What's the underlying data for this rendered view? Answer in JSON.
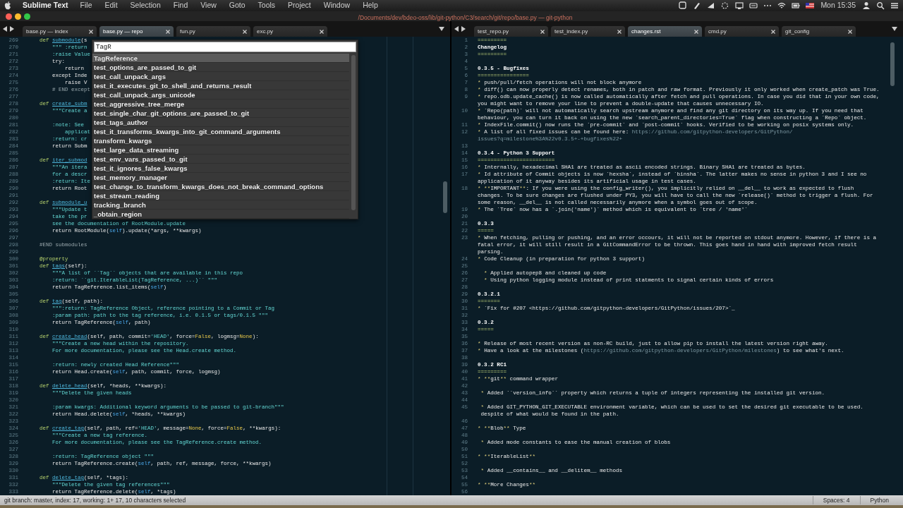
{
  "menubar": {
    "app": "Sublime Text",
    "menus": [
      "File",
      "Edit",
      "Selection",
      "Find",
      "View",
      "Goto",
      "Tools",
      "Project",
      "Window",
      "Help"
    ],
    "clock": "Mon 15:35"
  },
  "window": {
    "title": "/Documents/dev/bdeo-oss/lib/git-python/C3/search/git/repo/base.py — git-python"
  },
  "panes": [
    {
      "tabs": [
        {
          "label": "base.py — index",
          "selected": false
        },
        {
          "label": "base.py — repo",
          "selected": true
        },
        {
          "label": "fun.py",
          "selected": false
        },
        {
          "label": "exc.py",
          "selected": false
        }
      ],
      "lines": [
        {
          "n": "269",
          "parts": [
            {
              "kind": "kw",
              "text": "    def "
            },
            {
              "kind": "fn",
              "text": "submodule"
            },
            {
              "kind": "pl",
              "text": "(s"
            }
          ]
        },
        {
          "n": "270",
          "parts": [
            {
              "kind": "doc",
              "text": "        \"\"\" :return"
            }
          ]
        },
        {
          "n": "271",
          "parts": [
            {
              "kind": "doc",
              "text": "        :raise Value"
            }
          ]
        },
        {
          "n": "272",
          "parts": [
            {
              "kind": "pl",
              "text": "        try:"
            }
          ]
        },
        {
          "n": "273",
          "parts": [
            {
              "kind": "pl",
              "text": "            return"
            }
          ]
        },
        {
          "n": "274",
          "parts": [
            {
              "kind": "pl",
              "text": "        except Inde"
            }
          ]
        },
        {
          "n": "275",
          "parts": [
            {
              "kind": "pl",
              "text": "            raise V"
            }
          ]
        },
        {
          "n": "276",
          "parts": [
            {
              "kind": "cmt",
              "text": "        # END except"
            }
          ]
        },
        {
          "n": "277"
        },
        {
          "n": "278",
          "parts": [
            {
              "kind": "kw",
              "text": "    def "
            },
            {
              "kind": "fn",
              "text": "create_subm"
            }
          ]
        },
        {
          "n": "279",
          "parts": [
            {
              "kind": "doc",
              "text": "        \"\"\"Create a"
            }
          ]
        },
        {
          "n": "280"
        },
        {
          "n": "281",
          "parts": [
            {
              "kind": "doc",
              "text": "        :note: See"
            }
          ]
        },
        {
          "n": "282",
          "parts": [
            {
              "kind": "doc",
              "text": "            applicat"
            }
          ]
        },
        {
          "n": "283",
          "parts": [
            {
              "kind": "doc",
              "text": "        :return: cr"
            }
          ]
        },
        {
          "n": "284",
          "parts": [
            {
              "kind": "pl",
              "text": "        return Subm"
            }
          ]
        },
        {
          "n": "285"
        },
        {
          "n": "286",
          "parts": [
            {
              "kind": "kw",
              "text": "    def "
            },
            {
              "kind": "fn",
              "text": "iter_submod"
            }
          ]
        },
        {
          "n": "287",
          "parts": [
            {
              "kind": "doc",
              "text": "        \"\"\"An itera"
            }
          ]
        },
        {
          "n": "288",
          "parts": [
            {
              "kind": "doc",
              "text": "        for a descr"
            }
          ]
        },
        {
          "n": "289",
          "parts": [
            {
              "kind": "doc",
              "text": "        :return: Ite"
            }
          ]
        },
        {
          "n": "290",
          "parts": [
            {
              "kind": "pl",
              "text": "        return Root"
            }
          ]
        },
        {
          "n": "291"
        },
        {
          "n": "292",
          "parts": [
            {
              "kind": "kw",
              "text": "    def "
            },
            {
              "kind": "fn",
              "text": "submodule_u"
            }
          ]
        },
        {
          "n": "293",
          "parts": [
            {
              "kind": "doc",
              "text": "        \"\"\"Update t"
            }
          ]
        },
        {
          "n": "294",
          "parts": [
            {
              "kind": "doc",
              "text": "        take the pr"
            }
          ]
        },
        {
          "n": "295",
          "parts": [
            {
              "kind": "doc",
              "text": "        see the documentation of RootModule.update"
            }
          ]
        },
        {
          "n": "296",
          "parts": [
            {
              "kind": "pl",
              "text": "        return RootModule("
            },
            {
              "kind": "self",
              "text": "self"
            },
            {
              "kind": "pl",
              "text": ").update(*args, **kwargs)"
            }
          ]
        },
        {
          "n": "297"
        },
        {
          "n": "298",
          "parts": [
            {
              "kind": "cmt",
              "text": "    #END submodules"
            }
          ]
        },
        {
          "n": "299"
        },
        {
          "n": "300",
          "parts": [
            {
              "kind": "dec",
              "text": "    @property"
            }
          ]
        },
        {
          "n": "301",
          "parts": [
            {
              "kind": "kw",
              "text": "    def "
            },
            {
              "kind": "fn",
              "text": "tags"
            },
            {
              "kind": "pl",
              "text": "(self):"
            }
          ]
        },
        {
          "n": "302",
          "parts": [
            {
              "kind": "doc",
              "text": "        \"\"\"A list of ``Tag`` objects that are available in this repo"
            }
          ]
        },
        {
          "n": "303",
          "parts": [
            {
              "kind": "doc",
              "text": "        :return: ``git.IterableList(TagReference, ...)`` \"\"\""
            }
          ]
        },
        {
          "n": "304",
          "parts": [
            {
              "kind": "pl",
              "text": "        return TagReference.list_items("
            },
            {
              "kind": "self",
              "text": "self"
            },
            {
              "kind": "pl",
              "text": ")"
            }
          ]
        },
        {
          "n": "305"
        },
        {
          "n": "306",
          "parts": [
            {
              "kind": "kw",
              "text": "    def "
            },
            {
              "kind": "fn",
              "text": "tag"
            },
            {
              "kind": "pl",
              "text": "(self, path):"
            }
          ]
        },
        {
          "n": "307",
          "parts": [
            {
              "kind": "doc",
              "text": "        \"\"\":return: TagReference Object, reference pointing to a Commit or Tag"
            }
          ]
        },
        {
          "n": "308",
          "parts": [
            {
              "kind": "doc",
              "text": "        :param path: path to the tag reference, i.e. 0.1.5 or tags/0.1.5 \"\"\""
            }
          ]
        },
        {
          "n": "309",
          "parts": [
            {
              "kind": "pl",
              "text": "        return TagReference("
            },
            {
              "kind": "self",
              "text": "self"
            },
            {
              "kind": "pl",
              "text": ", path)"
            }
          ]
        },
        {
          "n": "310"
        },
        {
          "n": "311",
          "parts": [
            {
              "kind": "kw",
              "text": "    def "
            },
            {
              "kind": "fn",
              "text": "create_head"
            },
            {
              "kind": "pl",
              "text": "(self, path, commit="
            },
            {
              "kind": "doc",
              "text": "'HEAD'"
            },
            {
              "kind": "pl",
              "text": ", force="
            },
            {
              "kind": "const",
              "text": "False"
            },
            {
              "kind": "pl",
              "text": ", logmsg="
            },
            {
              "kind": "const",
              "text": "None"
            },
            {
              "kind": "pl",
              "text": "):"
            }
          ]
        },
        {
          "n": "312",
          "parts": [
            {
              "kind": "doc",
              "text": "        \"\"\"Create a new head within the repository."
            }
          ]
        },
        {
          "n": "313",
          "parts": [
            {
              "kind": "doc",
              "text": "        For more documentation, please see the Head.create method."
            }
          ]
        },
        {
          "n": "314"
        },
        {
          "n": "315",
          "parts": [
            {
              "kind": "doc",
              "text": "        :return: newly created Head Reference\"\"\""
            }
          ]
        },
        {
          "n": "316",
          "parts": [
            {
              "kind": "pl",
              "text": "        return Head.create("
            },
            {
              "kind": "self",
              "text": "self"
            },
            {
              "kind": "pl",
              "text": ", path, commit, force, logmsg)"
            }
          ]
        },
        {
          "n": "317"
        },
        {
          "n": "318",
          "parts": [
            {
              "kind": "kw",
              "text": "    def "
            },
            {
              "kind": "fn",
              "text": "delete_head"
            },
            {
              "kind": "pl",
              "text": "(self, *heads, **kwargs):"
            }
          ]
        },
        {
          "n": "319",
          "parts": [
            {
              "kind": "doc",
              "text": "        \"\"\"Delete the given heads"
            }
          ]
        },
        {
          "n": "320"
        },
        {
          "n": "321",
          "parts": [
            {
              "kind": "doc",
              "text": "        :param kwargs: Additional keyword arguments to be passed to git-branch\"\"\""
            }
          ]
        },
        {
          "n": "322",
          "parts": [
            {
              "kind": "pl",
              "text": "        return Head.delete("
            },
            {
              "kind": "self",
              "text": "self"
            },
            {
              "kind": "pl",
              "text": ", *heads, **kwargs)"
            }
          ]
        },
        {
          "n": "323"
        },
        {
          "n": "324",
          "parts": [
            {
              "kind": "kw",
              "text": "    def "
            },
            {
              "kind": "fn",
              "text": "create_tag"
            },
            {
              "kind": "pl",
              "text": "(self, path, ref="
            },
            {
              "kind": "doc",
              "text": "'HEAD'"
            },
            {
              "kind": "pl",
              "text": ", message="
            },
            {
              "kind": "const",
              "text": "None"
            },
            {
              "kind": "pl",
              "text": ", force="
            },
            {
              "kind": "const",
              "text": "False"
            },
            {
              "kind": "pl",
              "text": ", **kwargs):"
            }
          ]
        },
        {
          "n": "325",
          "parts": [
            {
              "kind": "doc",
              "text": "        \"\"\"Create a new tag reference."
            }
          ]
        },
        {
          "n": "326",
          "parts": [
            {
              "kind": "doc",
              "text": "        For more documentation, please see the TagReference.create method."
            }
          ]
        },
        {
          "n": "327"
        },
        {
          "n": "328",
          "parts": [
            {
              "kind": "doc",
              "text": "        :return: TagReference object \"\"\""
            }
          ]
        },
        {
          "n": "329",
          "parts": [
            {
              "kind": "pl",
              "text": "        return TagReference.create("
            },
            {
              "kind": "self",
              "text": "self"
            },
            {
              "kind": "pl",
              "text": ", path, ref, message, force, **kwargs)"
            }
          ]
        },
        {
          "n": "330"
        },
        {
          "n": "331",
          "parts": [
            {
              "kind": "kw",
              "text": "    def "
            },
            {
              "kind": "fn",
              "text": "delete_tag"
            },
            {
              "kind": "pl",
              "text": "(self, *tags):"
            }
          ]
        },
        {
          "n": "332",
          "parts": [
            {
              "kind": "doc",
              "text": "        \"\"\"Delete the given tag references\"\"\""
            }
          ]
        },
        {
          "n": "333",
          "parts": [
            {
              "kind": "pl",
              "text": "        return TagReference.delete("
            },
            {
              "kind": "self",
              "text": "self"
            },
            {
              "kind": "pl",
              "text": ", *tags)"
            }
          ]
        }
      ],
      "autocomplete": {
        "value": "TagR",
        "items": [
          {
            "label": "TagReference",
            "selected": true
          },
          {
            "label": "test_options_are_passed_to_git",
            "selected": false
          },
          {
            "label": "test_call_unpack_args",
            "selected": false
          },
          {
            "label": "test_it_executes_git_to_shell_and_returns_result",
            "selected": false
          },
          {
            "label": "test_call_unpack_args_unicode",
            "selected": false
          },
          {
            "label": "test_aggressive_tree_merge",
            "selected": false
          },
          {
            "label": "test_single_char_git_options_are_passed_to_git",
            "selected": false
          },
          {
            "label": "test_tags_author",
            "selected": false
          },
          {
            "label": "test_it_transforms_kwargs_into_git_command_arguments",
            "selected": false
          },
          {
            "label": "transform_kwargs",
            "selected": false
          },
          {
            "label": "test_large_data_streaming",
            "selected": false
          },
          {
            "label": "test_env_vars_passed_to_git",
            "selected": false
          },
          {
            "label": "test_it_ignores_false_kwargs",
            "selected": false
          },
          {
            "label": "test_memory_manager",
            "selected": false
          },
          {
            "label": "test_change_to_transform_kwargs_does_not_break_command_options",
            "selected": false
          },
          {
            "label": "test_stream_reading",
            "selected": false
          },
          {
            "label": "tracking_branch",
            "selected": false
          },
          {
            "label": "_obtain_region",
            "selected": false
          }
        ]
      }
    },
    {
      "tabs": [
        {
          "label": "test_repo.py",
          "selected": false
        },
        {
          "label": "test_index.py",
          "selected": false
        },
        {
          "label": "changes.rst",
          "selected": true
        },
        {
          "label": "cmd.py",
          "selected": false
        },
        {
          "label": "git_config",
          "selected": false
        }
      ],
      "lines": [
        {
          "n": "1",
          "parts": [
            {
              "kind": "rule",
              "text": "========="
            }
          ]
        },
        {
          "n": "2",
          "parts": [
            {
              "kind": "head",
              "text": "Changelog"
            }
          ]
        },
        {
          "n": "3",
          "parts": [
            {
              "kind": "rule",
              "text": "========="
            }
          ]
        },
        {
          "n": "4"
        },
        {
          "n": "5",
          "parts": [
            {
              "kind": "head",
              "text": "0.3.5 - Bugfixes"
            }
          ]
        },
        {
          "n": "6",
          "parts": [
            {
              "kind": "rule",
              "text": "================"
            }
          ]
        },
        {
          "n": "7",
          "parts": [
            {
              "kind": "bul",
              "text": "* "
            },
            {
              "kind": "txt",
              "text": "push/pull/fetch operations will not block anymore"
            }
          ]
        },
        {
          "n": "8",
          "parts": [
            {
              "kind": "bul",
              "text": "* "
            },
            {
              "kind": "txt",
              "text": "diff() can now properly detect renames, both in patch and raw format. Previously it only worked when create_patch was True."
            }
          ]
        },
        {
          "n": "9",
          "parts": [
            {
              "kind": "bul",
              "text": "* "
            },
            {
              "kind": "txt",
              "text": "repo.odb.update_cache() is now called automatically after fetch and pull operations. In case you did that in your own code,"
            }
          ]
        },
        {
          "parts": [
            {
              "kind": "txt",
              "text": "you might want to remove your line to prevent a double-update that causes unnecessary IO."
            }
          ]
        },
        {
          "n": "10",
          "parts": [
            {
              "kind": "bul",
              "text": "* "
            },
            {
              "kind": "txt",
              "text": "`Repo(path)` will not automatically search upstream anymore and find any git directory on its way up. If you need that"
            }
          ]
        },
        {
          "parts": [
            {
              "kind": "txt",
              "text": "behaviour, you can turn it back on using the new `search_parent_directories=True` flag when constructing a `Repo` object."
            }
          ]
        },
        {
          "n": "11",
          "parts": [
            {
              "kind": "bul",
              "text": "* "
            },
            {
              "kind": "txt",
              "text": "IndexFile.commit() now runs the `pre-commit` and `post-commit` hooks. Verified to be working on posix systems only."
            }
          ]
        },
        {
          "n": "12",
          "parts": [
            {
              "kind": "bul",
              "text": "* "
            },
            {
              "kind": "txt",
              "text": "A list of all fixed issues can be found here: "
            },
            {
              "kind": "link",
              "text": "https://github.com/gitpython-developers/GitPython/"
            }
          ]
        },
        {
          "parts": [
            {
              "kind": "link",
              "text": "issues?q=milestone%3A%22v0.3.5+-+bugfixes%22+"
            }
          ]
        },
        {
          "n": "13"
        },
        {
          "n": "14",
          "parts": [
            {
              "kind": "head",
              "text": "0.3.4 - Python 3 Support"
            }
          ]
        },
        {
          "n": "15",
          "parts": [
            {
              "kind": "rule",
              "text": "========================"
            }
          ]
        },
        {
          "n": "16",
          "parts": [
            {
              "kind": "bul",
              "text": "* "
            },
            {
              "kind": "txt",
              "text": "Internally, hexadecimal SHA1 are treated as ascii encoded strings. Binary SHA1 are treated as bytes."
            }
          ]
        },
        {
          "n": "17",
          "parts": [
            {
              "kind": "bul",
              "text": "* "
            },
            {
              "kind": "txt",
              "text": "Id attribute of Commit objects is now `hexsha`, instead of `binsha`. The latter makes no sense in python 3 and I see no"
            }
          ]
        },
        {
          "parts": [
            {
              "kind": "txt",
              "text": "application of it anyway besides its artificial usage in test cases."
            }
          ]
        },
        {
          "n": "18",
          "parts": [
            {
              "kind": "bul",
              "text": "* **"
            },
            {
              "kind": "txt",
              "text": "IMPORTANT"
            },
            {
              "kind": "bul",
              "text": "**"
            },
            {
              "kind": "txt",
              "text": ": If you were using the config_writer(), you implicitly relied on __del__ to work as expected to flush"
            }
          ]
        },
        {
          "parts": [
            {
              "kind": "txt",
              "text": "changes. To be sure changes are flushed under PY3, you will have to call the new `release()` method to trigger a flush. For"
            }
          ]
        },
        {
          "parts": [
            {
              "kind": "txt",
              "text": "some reason, __del__ is not called necessarily anymore when a symbol goes out of scope."
            }
          ]
        },
        {
          "n": "19",
          "parts": [
            {
              "kind": "bul",
              "text": "* "
            },
            {
              "kind": "txt",
              "text": "The `Tree` now has a `.join('name')` method which is equivalent to `tree / 'name'`"
            }
          ]
        },
        {
          "n": "20"
        },
        {
          "n": "21",
          "parts": [
            {
              "kind": "head",
              "text": "0.3.3"
            }
          ]
        },
        {
          "n": "22",
          "parts": [
            {
              "kind": "rule",
              "text": "====="
            }
          ]
        },
        {
          "n": "23",
          "parts": [
            {
              "kind": "bul",
              "text": "* "
            },
            {
              "kind": "txt",
              "text": "When fetching, pulling or pushing, and an error occours, it will not be reported on stdout anymore. However, if there is a"
            }
          ]
        },
        {
          "parts": [
            {
              "kind": "txt",
              "text": "fatal error, it will still result in a GitCommandError to be thrown. This goes hand in hand with improved fetch result"
            }
          ]
        },
        {
          "parts": [
            {
              "kind": "txt",
              "text": "parsing."
            }
          ]
        },
        {
          "n": "24",
          "parts": [
            {
              "kind": "bul",
              "text": "* "
            },
            {
              "kind": "txt",
              "text": "Code Cleanup (in preparation for python 3 support)"
            }
          ]
        },
        {
          "n": "25"
        },
        {
          "n": "26",
          "parts": [
            {
              "kind": "bul",
              "text": "  * "
            },
            {
              "kind": "txt",
              "text": "Applied autopep8 and cleaned up code"
            }
          ]
        },
        {
          "n": "27",
          "parts": [
            {
              "kind": "bul",
              "text": "  * "
            },
            {
              "kind": "txt",
              "text": "Using python logging module instead of print statments to signal certain kinds of errors"
            }
          ]
        },
        {
          "n": "28"
        },
        {
          "n": "29",
          "parts": [
            {
              "kind": "head",
              "text": "0.3.2.1"
            }
          ]
        },
        {
          "n": "30",
          "parts": [
            {
              "kind": "rule",
              "text": "======="
            }
          ]
        },
        {
          "n": "31",
          "parts": [
            {
              "kind": "bul",
              "text": "* "
            },
            {
              "kind": "txt",
              "text": "`Fix for #207 <https://github.com/gitpython-developers/GitPython/issues/207>`_"
            }
          ]
        },
        {
          "n": "32"
        },
        {
          "n": "33",
          "parts": [
            {
              "kind": "head",
              "text": "0.3.2"
            }
          ]
        },
        {
          "n": "34",
          "parts": [
            {
              "kind": "rule",
              "text": "====="
            }
          ]
        },
        {
          "n": "35"
        },
        {
          "n": "36",
          "parts": [
            {
              "kind": "bul",
              "text": "* "
            },
            {
              "kind": "txt",
              "text": "Release of most recent version as non-RC build, just to allow pip to install the latest version right away."
            }
          ]
        },
        {
          "n": "37",
          "parts": [
            {
              "kind": "bul",
              "text": "* "
            },
            {
              "kind": "txt",
              "text": "Have a look at the milestones ("
            },
            {
              "kind": "link",
              "text": "https://github.com/gitpython-developers/GitPython/milestones"
            },
            {
              "kind": "txt",
              "text": ") to see what's next."
            }
          ]
        },
        {
          "n": "38"
        },
        {
          "n": "39",
          "parts": [
            {
              "kind": "head",
              "text": "0.3.2 RC1"
            }
          ]
        },
        {
          "n": "40",
          "parts": [
            {
              "kind": "rule",
              "text": "========="
            }
          ]
        },
        {
          "n": "41",
          "parts": [
            {
              "kind": "bul",
              "text": "* **"
            },
            {
              "kind": "txt",
              "text": "git"
            },
            {
              "kind": "bul",
              "text": "**"
            },
            {
              "kind": "txt",
              "text": " command wrapper"
            }
          ]
        },
        {
          "n": "42"
        },
        {
          "n": "43",
          "parts": [
            {
              "kind": "bul",
              "text": " * "
            },
            {
              "kind": "txt",
              "text": "Added ``version_info`` property which returns a tuple of integers representing the installed git version."
            }
          ]
        },
        {
          "n": "44"
        },
        {
          "n": "45",
          "parts": [
            {
              "kind": "bul",
              "text": " * "
            },
            {
              "kind": "txt",
              "text": "Added GIT_PYTHON_GIT_EXECUTABLE environment variable, which can be used to set the desired git executable to be used."
            }
          ]
        },
        {
          "parts": [
            {
              "kind": "txt",
              "text": " despite of what would be found in the path."
            }
          ]
        },
        {
          "n": "46"
        },
        {
          "n": "47",
          "parts": [
            {
              "kind": "bul",
              "text": "* **"
            },
            {
              "kind": "txt",
              "text": "Blob"
            },
            {
              "kind": "bul",
              "text": "**"
            },
            {
              "kind": "txt",
              "text": " Type"
            }
          ]
        },
        {
          "n": "48"
        },
        {
          "n": "49",
          "parts": [
            {
              "kind": "bul",
              "text": " * "
            },
            {
              "kind": "txt",
              "text": "Added mode constants to ease the manual creation of blobs"
            }
          ]
        },
        {
          "n": "50"
        },
        {
          "n": "51",
          "parts": [
            {
              "kind": "bul",
              "text": "* **"
            },
            {
              "kind": "txt",
              "text": "IterableList"
            },
            {
              "kind": "bul",
              "text": "**"
            }
          ]
        },
        {
          "n": "52"
        },
        {
          "n": "53",
          "parts": [
            {
              "kind": "bul",
              "text": " * "
            },
            {
              "kind": "txt",
              "text": "Added __contains__ and __delitem__ methods"
            }
          ]
        },
        {
          "n": "54"
        },
        {
          "n": "55",
          "parts": [
            {
              "kind": "bul",
              "text": "* **"
            },
            {
              "kind": "txt",
              "text": "More Changes"
            },
            {
              "kind": "bul",
              "text": "**"
            }
          ]
        },
        {
          "n": "56"
        }
      ]
    }
  ],
  "status_bar": {
    "message": "git branch: master, index: 17, working: 1+ 17, 10 characters selected",
    "indentation": "Spaces: 4",
    "syntax": "Python"
  }
}
